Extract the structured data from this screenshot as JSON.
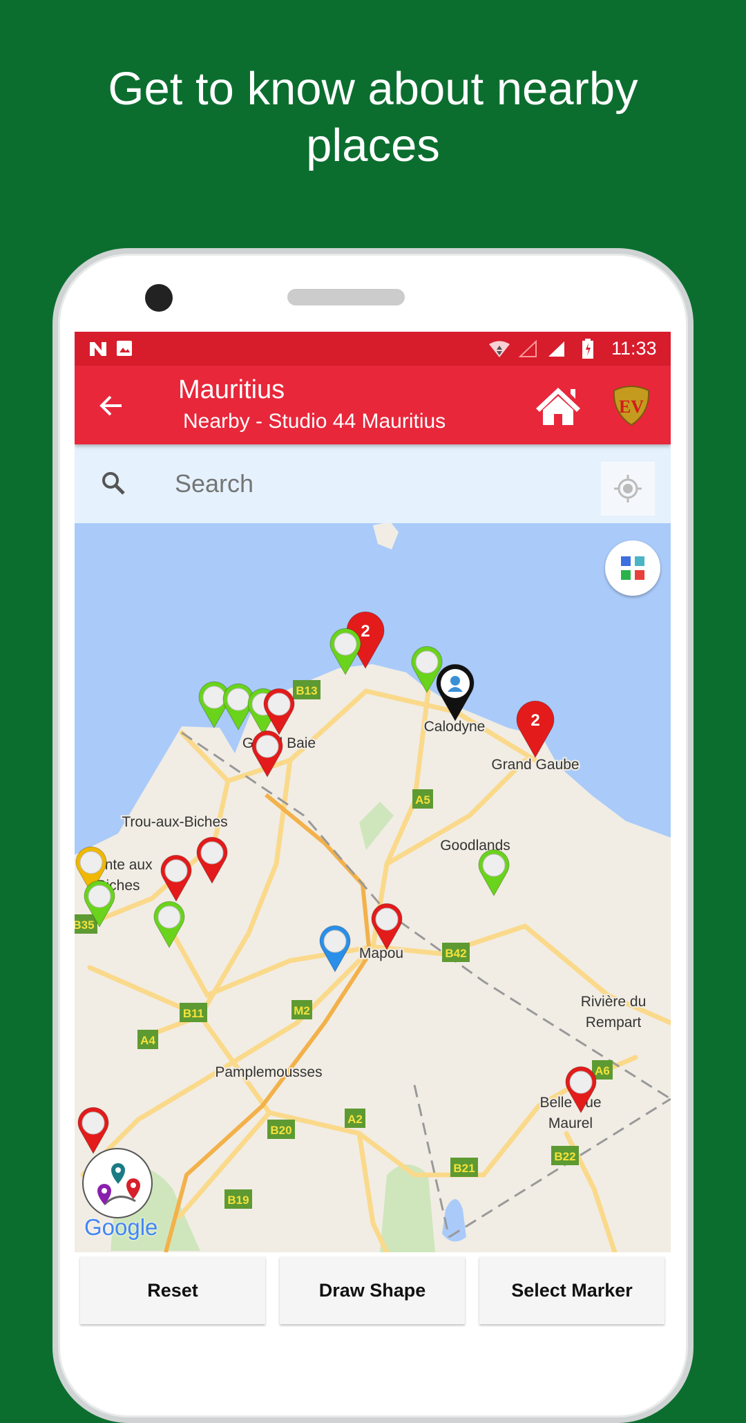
{
  "headline": "Get to know about nearby places",
  "status_bar": {
    "time": "11:33",
    "left_icons": [
      "n-logo-icon",
      "image-icon"
    ],
    "right_icons": [
      "wifi-icon",
      "signal-empty-icon",
      "signal-full-icon",
      "battery-charging-icon"
    ]
  },
  "app_bar": {
    "title": "Mauritius",
    "subtitle": "Nearby - Studio 44 Mauritius",
    "back_icon": "arrow-left-icon",
    "home_icon": "home-icon",
    "logo_text": "EV"
  },
  "search": {
    "placeholder": "Search",
    "icon": "search-icon",
    "location_icon": "my-location-icon"
  },
  "map": {
    "colors": {
      "water": "#aacbf9",
      "land": "#f1ede4",
      "road": "#fad98b",
      "motorway": "#f3b14a",
      "park": "#cfe6bd"
    },
    "places": [
      "Calodyne",
      "Grand Gaube",
      "Grand Baie",
      "Trou-aux-Biches",
      "Pointe aux",
      "Biches",
      "Goodlands",
      "Mapou",
      "Rivière du",
      "Rempart",
      "Pamplemousses",
      "Belle Vue",
      "Maurel"
    ],
    "road_shields": [
      "B13",
      "A5",
      "B42",
      "B11",
      "M2",
      "A4",
      "A6",
      "B20",
      "A2",
      "B21",
      "B22",
      "B19",
      "B35"
    ],
    "markers": [
      {
        "color": "#e31b1b",
        "count": "2"
      },
      {
        "color": "#6ad31c"
      },
      {
        "color": "#6ad31c"
      },
      {
        "color": "#111111",
        "type": "user"
      },
      {
        "color": "#e31b1b",
        "count": "2"
      },
      {
        "color": "#6ad31c"
      },
      {
        "color": "#6ad31c"
      },
      {
        "color": "#6ad31c"
      },
      {
        "color": "#e31b1b"
      },
      {
        "color": "#e31b1b"
      },
      {
        "color": "#e31b1b"
      },
      {
        "color": "#e31b1b"
      },
      {
        "color": "#f0b800"
      },
      {
        "color": "#6ad31c"
      },
      {
        "color": "#6ad31c"
      },
      {
        "color": "#2a8fe8"
      },
      {
        "color": "#e31b1b"
      },
      {
        "color": "#6ad31c"
      },
      {
        "color": "#e31b1b"
      },
      {
        "color": "#e31b1b"
      }
    ],
    "layers_icon": "grid-icon",
    "google_label": "Google"
  },
  "buttons": {
    "reset": "Reset",
    "draw_shape": "Draw Shape",
    "select_marker": "Select Marker"
  }
}
